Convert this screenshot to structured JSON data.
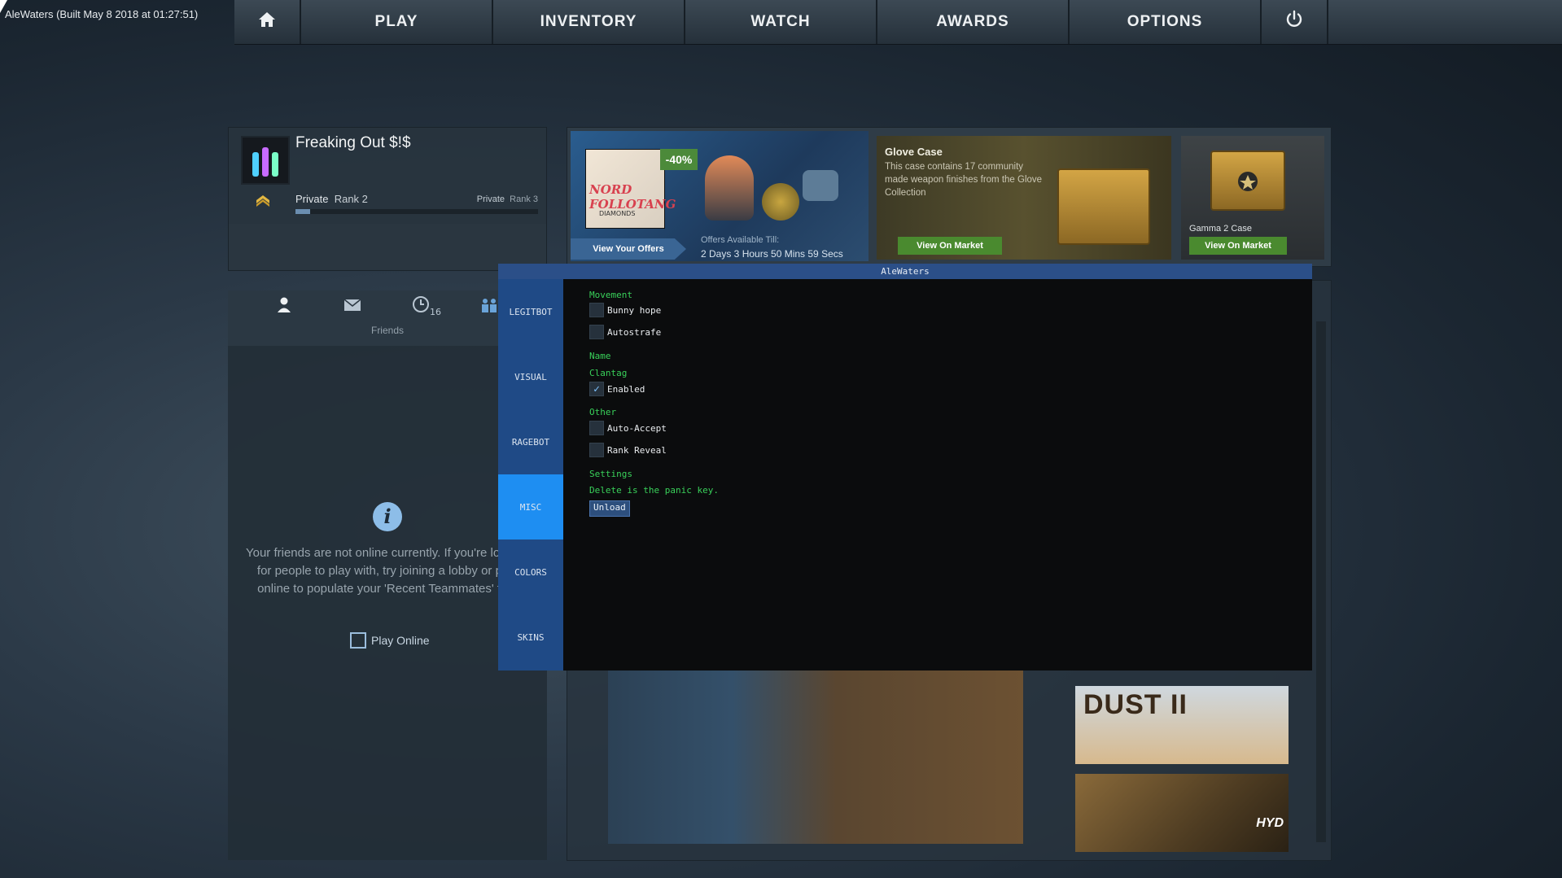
{
  "build_info": "AleWaters (Built May  8 2018 at 01:27:51)",
  "nav": {
    "home_icon": "home-icon",
    "items": [
      {
        "label": "PLAY"
      },
      {
        "label": "INVENTORY"
      },
      {
        "label": "WATCH"
      },
      {
        "label": "AWARDS"
      },
      {
        "label": "OPTIONS"
      }
    ],
    "power_icon": "power-icon"
  },
  "profile": {
    "name": "Freaking Out $!$",
    "current_rank_title": "Private",
    "current_rank_level": "Rank 2",
    "next_rank_title": "Private",
    "next_rank_level": "Rank 3",
    "xp_progress": 0.06
  },
  "friends": {
    "tab_label": "Friends",
    "history_count": "16",
    "message": "Your friends are not online currently.  If you're looking for people to play with, try joining a lobby or play online to populate your 'Recent Teammates' tab.",
    "play_online": "Play Online"
  },
  "banners": {
    "offer": {
      "album_text": "NORD FOLLOTANG",
      "album_sub": "DIAMONDS",
      "discount": "-40%",
      "button": "View Your Offers",
      "available_label": "Offers Available Till:",
      "available_time": "2 Days  3 Hours  50 Mins  59 Secs"
    },
    "glove_case": {
      "title": "Glove Case",
      "description": "This case contains 17 community made weapon finishes from the Glove Collection",
      "button": "View On Market"
    },
    "gamma_case": {
      "title": "Gamma 2 Case",
      "button": "View On Market"
    }
  },
  "maps": {
    "dust2": "DUST II",
    "hydra": "HYD"
  },
  "cheat_menu": {
    "title": "AleWaters",
    "tabs": [
      "LEGITBOT",
      "VISUAL",
      "RAGEBOT",
      "MISC",
      "COLORS",
      "SKINS"
    ],
    "active_tab": "MISC",
    "movement": {
      "label": "Movement",
      "bunny_hop": "Bunny hope",
      "autostrafe": "Autostrafe"
    },
    "name_label": "Name",
    "clantag": {
      "label": "Clantag",
      "enabled": "Enabled"
    },
    "other": {
      "label": "Other",
      "auto_accept": "Auto-Accept",
      "rank_reveal": "Rank Reveal"
    },
    "settings": {
      "label": "Settings",
      "panic_note": "Delete is the panic key.",
      "unload": "Unload"
    }
  },
  "colors": {
    "accent_green": "#39d15a",
    "active_tab": "#1e8ef2",
    "sidebar": "#1f4a86",
    "market_button": "#4a8a2f"
  }
}
